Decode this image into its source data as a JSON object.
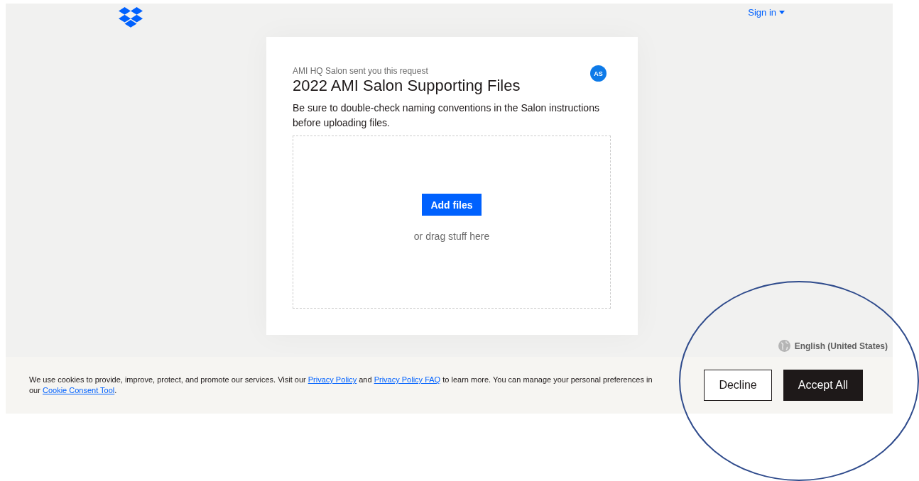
{
  "header": {
    "sign_in": "Sign in"
  },
  "request": {
    "sender": "AMI HQ Salon sent you this request",
    "avatar": "AS",
    "title": "2022 AMI Salon Supporting Files",
    "description": "Be sure to double-check naming conventions in the Salon instructions before uploading files.",
    "upload_button": "Add files",
    "drop_hint": "or drag stuff here"
  },
  "language": "English (United States)",
  "cookie_banner": {
    "parts": [
      {
        "kind": "text",
        "text": "We use cookies to provide, improve, protect, and promote our services. Visit our "
      },
      {
        "kind": "link",
        "text": "Privacy Policy"
      },
      {
        "kind": "text",
        "text": " and "
      },
      {
        "kind": "link",
        "text": "Privacy Policy FAQ"
      },
      {
        "kind": "text",
        "text": " to learn more. You can manage your personal preferences in our "
      },
      {
        "kind": "link",
        "text": "Cookie Consent Tool"
      },
      {
        "kind": "text",
        "text": "."
      }
    ],
    "buttons": [
      {
        "label": "Decline",
        "kind": "secondary"
      },
      {
        "label": "Accept All",
        "kind": "primary"
      }
    ]
  },
  "annotation": {
    "kind": "ellipse"
  }
}
